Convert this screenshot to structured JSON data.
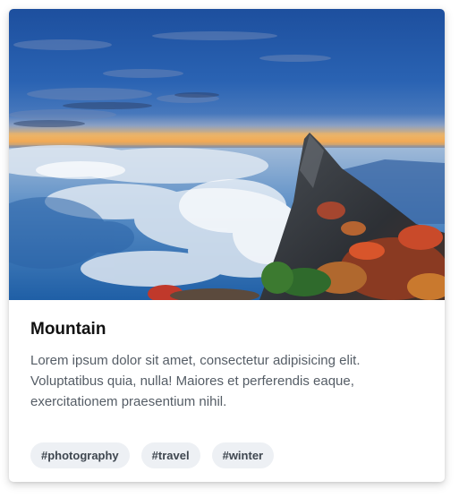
{
  "card": {
    "image": {
      "name": "mountain-photo",
      "description": ""
    },
    "title": "Mountain",
    "text": "Lorem ipsum dolor sit amet, consectetur adipisicing elit. Voluptatibus quia, nulla! Maiores et perferendis eaque, exercitationem praesentium nihil.",
    "tags": [
      "#photography",
      "#travel",
      "#winter"
    ]
  },
  "colors": {
    "tag_bg": "#edf0f4",
    "tag_text": "#3f4750",
    "body_text": "#555d66",
    "title_text": "#111111"
  }
}
